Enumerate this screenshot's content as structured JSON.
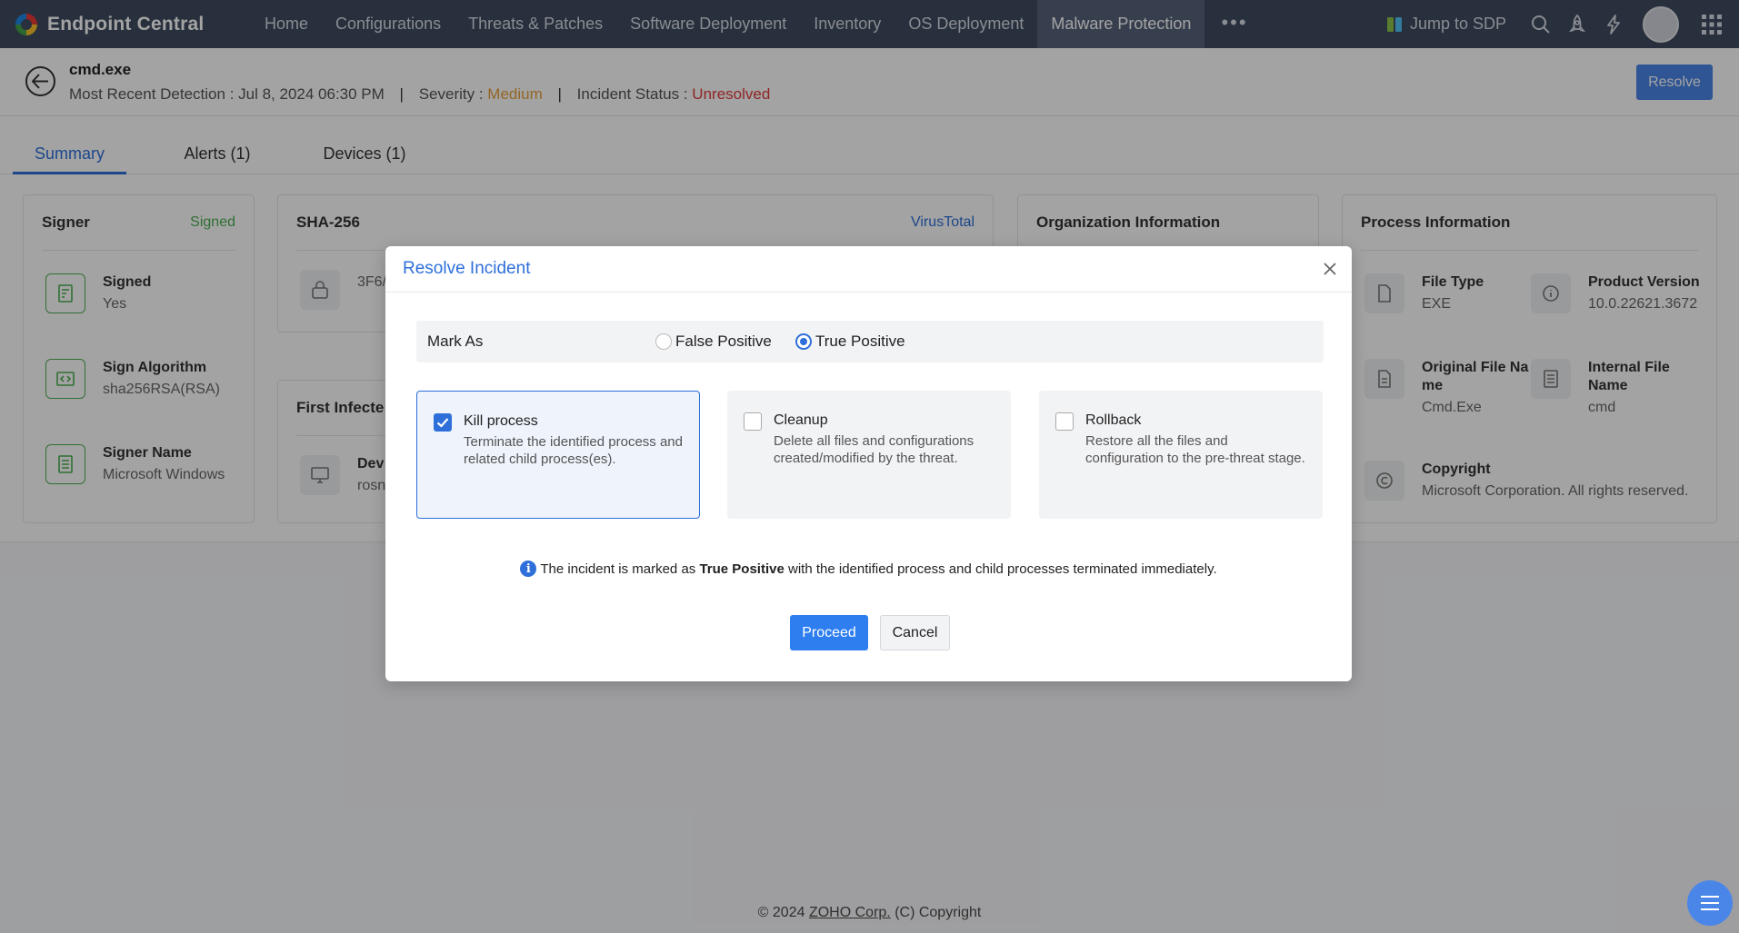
{
  "app": {
    "name": "Endpoint Central",
    "nav": [
      "Home",
      "Configurations",
      "Threats & Patches",
      "Software Deployment",
      "Inventory",
      "OS Deployment",
      "Malware Protection"
    ],
    "active_nav": "Malware Protection",
    "more": "•••",
    "jump_label": "Jump to SDP"
  },
  "incident": {
    "title": "cmd.exe",
    "detection_label": "Most Recent Detection : ",
    "detection_value": "Jul 8, 2024 06:30 PM",
    "severity_label": "Severity : ",
    "severity_value": "Medium",
    "status_label": "Incident Status : ",
    "status_value": "Unresolved",
    "resolve_button": "Resolve",
    "sep": "|"
  },
  "tabs": [
    "Summary",
    "Alerts (1)",
    "Devices (1)"
  ],
  "cards": {
    "signer": {
      "title": "Signer",
      "badge": "Signed",
      "items": [
        {
          "label": "Signed",
          "value": "Yes"
        },
        {
          "label": "Sign Algorithm",
          "value": "sha256RSA(RSA)"
        },
        {
          "label": "Signer Name",
          "value": "Microsoft Windows"
        }
      ]
    },
    "sha": {
      "title": "SHA-256",
      "link": "VirusTotal",
      "hash_partial": "3F6/"
    },
    "first_infected": {
      "title": "First Infecte",
      "label": "Dev",
      "value": "rosn"
    },
    "org": {
      "title": "Organization Information"
    },
    "process": {
      "title": "Process Information",
      "items": [
        {
          "label": "File Type",
          "value": "EXE"
        },
        {
          "label": "Product Version",
          "value": "10.0.22621.3672"
        },
        {
          "label": "Original File Na me",
          "value": "Cmd.Exe"
        },
        {
          "label": "Internal File Name",
          "value": "cmd"
        },
        {
          "label": "Copyright",
          "value": "Microsoft Corporation. All rights reserved."
        }
      ]
    }
  },
  "modal": {
    "title": "Resolve Incident",
    "mark_as_label": "Mark As",
    "radio_options": [
      {
        "label": "False Positive",
        "selected": false
      },
      {
        "label": "True Positive",
        "selected": true
      }
    ],
    "options": [
      {
        "title": "Kill process",
        "desc": "Terminate the identified process and related child process(es).",
        "checked": true
      },
      {
        "title": "Cleanup",
        "desc": "Delete all files and configurations created/modified by the threat.",
        "checked": false
      },
      {
        "title": "Rollback",
        "desc": "Restore all the files and configuration to the pre-threat stage.",
        "checked": false
      }
    ],
    "info_prefix": "The incident is marked as ",
    "info_bold": "True Positive",
    "info_suffix": " with the identified process and child processes terminated immediately.",
    "proceed": "Proceed",
    "cancel": "Cancel"
  },
  "footer": {
    "prefix": "© 2024 ",
    "link": "ZOHO Corp.",
    "suffix": " (C) Copyright"
  },
  "colors": {
    "accent": "#2e6fd9",
    "nav_bg": "#3f4c60",
    "severity": "#e6a23c",
    "status": "#e23b3b",
    "signed": "#4caf50"
  }
}
